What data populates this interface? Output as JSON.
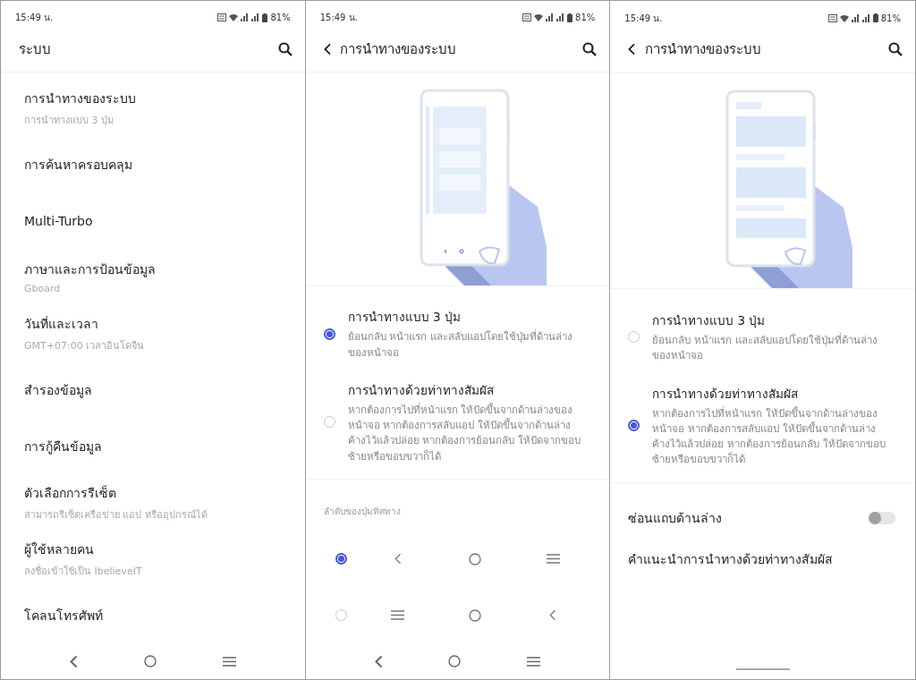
{
  "screens": [
    {
      "kind": "list",
      "status": {
        "time": "15:49 น.",
        "battery": "81%"
      },
      "header": {
        "title": "ระบบ"
      },
      "items": [
        {
          "title": "การนำทางของระบบ",
          "subtitle": "การนำทางแบบ 3 ปุ่ม"
        },
        {
          "title": "การค้นหาครอบคลุม"
        },
        {
          "title": "Multi-Turbo"
        },
        {
          "title": "ภาษาและการป้อนข้อมูล",
          "subtitle": "Gboard"
        },
        {
          "title": "วันที่และเวลา",
          "subtitle": "GMT+07:00 เวลาอินโดจีน"
        },
        {
          "title": "สำรองข้อมูล"
        },
        {
          "title": "การกู้คืนข้อมูล"
        },
        {
          "title": "ตัวเลือกการรีเซ็ต",
          "subtitle": "สามารถรีเซ็ตเครือข่าย แอป หรืออุปกรณ์ได้"
        },
        {
          "title": "ผู้ใช้หลายคน",
          "subtitle": "ลงชื่อเข้าใช้เป็น IbelieveIT"
        },
        {
          "title": "โคลนโทรศัพท์"
        }
      ],
      "nav": {
        "kind": "buttons"
      }
    },
    {
      "kind": "navigation",
      "status": {
        "time": "15:49 น.",
        "battery": "81%"
      },
      "header": {
        "back": true,
        "title": "การนำทางของระบบ"
      },
      "illustration": {
        "kind": "buttons"
      },
      "options": [
        {
          "title": "การนำทางแบบ 3 ปุ่ม",
          "description": "ย้อนกลับ หน้าแรก และสลับแอปโดยใช้ปุ่มที่ด้านล่างของหน้าจอ",
          "selected": true
        },
        {
          "title": "การนำทางด้วยท่าทางสัมผัส",
          "description": "หากต้องการไปที่หน้าแรก ให้ปัดขึ้นจากด้านล่างของหน้าจอ หากต้องการสลับแอป ให้ปัดขึ้นจากด้านล่างค้างไว้แล้วปล่อย หากต้องการย้อนกลับ ให้ปัดจากขอบซ้ายหรือขอบขวาก็ได้",
          "selected": false
        }
      ],
      "order": {
        "label": "ลำดับของปุ่มทิศทาง",
        "rows": [
          {
            "selected": true,
            "buttons": [
              {
                "kind": "back"
              },
              {
                "kind": "home"
              },
              {
                "kind": "recents"
              }
            ]
          },
          {
            "selected": false,
            "buttons": [
              {
                "kind": "recents"
              },
              {
                "kind": "home"
              },
              {
                "kind": "back"
              }
            ]
          }
        ]
      },
      "nav": {
        "kind": "buttons"
      }
    },
    {
      "kind": "navigation",
      "status": {
        "time": "15:49 น.",
        "battery": "81%"
      },
      "header": {
        "back": true,
        "title": "การนำทางของระบบ"
      },
      "illustration": {
        "kind": "gesture"
      },
      "options": [
        {
          "title": "การนำทางแบบ 3 ปุ่ม",
          "description": "ย้อนกลับ หน้าแรก และสลับแอปโดยใช้ปุ่มที่ด้านล่างของหน้าจอ",
          "selected": false
        },
        {
          "title": "การนำทางด้วยท่าทางสัมผัส",
          "description": "หากต้องการไปที่หน้าแรก ให้ปัดขึ้นจากด้านล่างของหน้าจอ หากต้องการสลับแอป ให้ปัดขึ้นจากด้านล่างค้างไว้แล้วปล่อย หากต้องการย้อนกลับ ให้ปัดจากขอบซ้ายหรือขอบขวาก็ได้",
          "selected": true
        }
      ],
      "toggle": {
        "label": "ซ่อนแถบด้านล่าง",
        "on": false
      },
      "link": "คำแนะนำการนำทางด้วยท่าทางสัมผัส",
      "nav": {
        "kind": "gesture"
      }
    }
  ]
}
